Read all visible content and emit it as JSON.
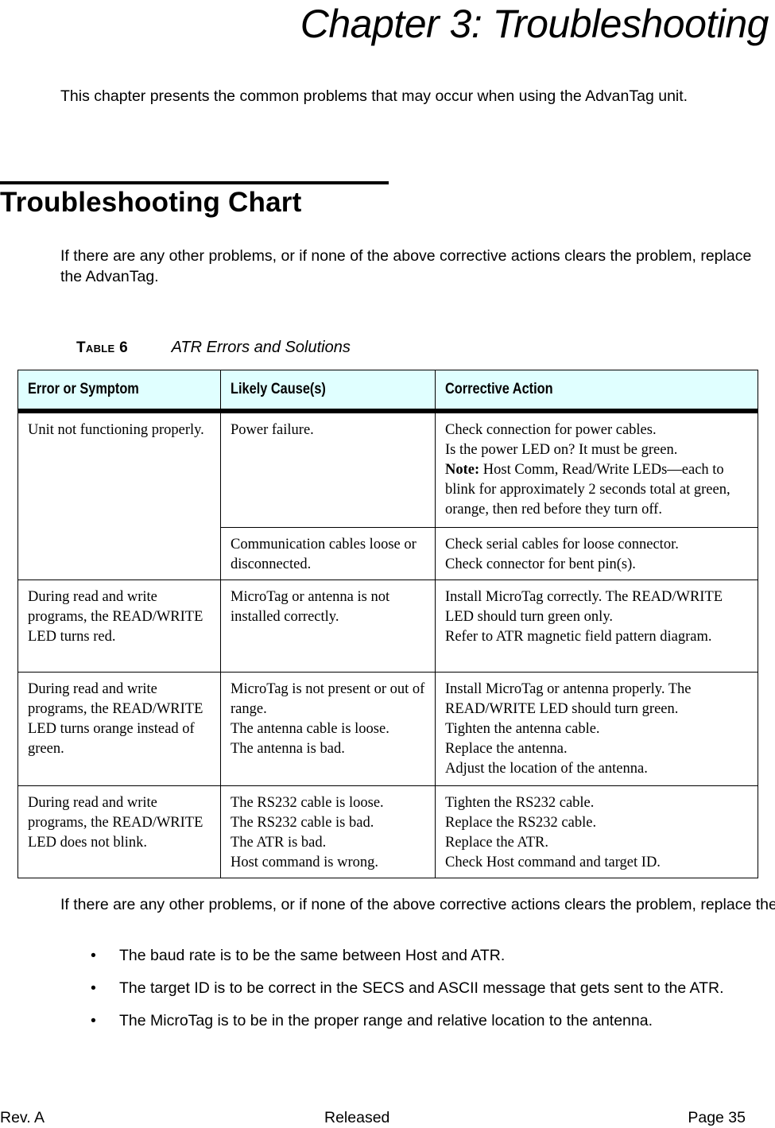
{
  "chapter": {
    "title": "Chapter 3:  Troubleshooting"
  },
  "intro": {
    "text": "This chapter presents the common problems that may occur when using the AdvanTag unit."
  },
  "section": {
    "title": "Troubleshooting Chart",
    "paragraph": "If there are any other problems, or if none of the above corrective actions clears the problem, replace the AdvanTag."
  },
  "table": {
    "caption_label": "Table 6",
    "caption_title": "ATR Errors and Solutions",
    "header_bg": "#e0ffff",
    "columns": [
      "Error or Symptom",
      "Likely Cause(s)",
      "Corrective Action"
    ],
    "rows": [
      {
        "symptom": "Unit not functioning properly.",
        "causes": [
          {
            "cause": [
              "Power failure."
            ],
            "actions": [
              "Check connection for power cables.",
              "Is the power LED on? It must be green."
            ],
            "note_label": "Note:",
            "note_text": " Host Comm, Read/Write LEDs—each to blink for approximately 2 seconds total at green, orange, then red before they turn off."
          },
          {
            "cause": [
              "Communication cables loose or disconnected."
            ],
            "actions": [
              "Check serial cables for loose connector.",
              "Check connector for bent pin(s)."
            ]
          }
        ]
      },
      {
        "symptom": "During read and write programs, the READ/WRITE LED turns red.",
        "cause": [
          "MicroTag or antenna is not installed correctly."
        ],
        "actions": [
          "Install MicroTag correctly. The READ/WRITE LED should turn green only.",
          "Refer to ATR magnetic field pattern diagram."
        ]
      },
      {
        "symptom": "During read and write programs, the READ/WRITE LED turns orange instead of green.",
        "cause": [
          "MicroTag is not present or out of range.",
          "The antenna cable is loose.",
          "The antenna is bad."
        ],
        "actions": [
          "Install MicroTag or antenna properly. The READ/WRITE LED should turn green.",
          "Tighten the antenna cable.",
          "Replace the antenna.",
          "Adjust the location of the antenna."
        ]
      },
      {
        "symptom": "During read and write programs, the READ/WRITE LED does not blink.",
        "cause": [
          "The RS232 cable is loose.",
          "The RS232 cable is bad.",
          "The ATR is bad.",
          "Host command is wrong."
        ],
        "actions": [
          "Tighten the RS232 cable.",
          "Replace the RS232 cable.",
          "Replace the ATR.",
          "Check Host command and target ID."
        ]
      }
    ]
  },
  "after_table": {
    "paragraph": "If there are any other problems, or if none of the above corrective actions clears the problem, replace the AdvanTag. Other considerations to assure proper ATR functioning:",
    "bullet_glyph": "•",
    "bullets": [
      "The baud rate is to be the same between Host and ATR.",
      "The target ID is to be correct in the SECS and ASCII message that gets sent to the ATR.",
      "The MicroTag is to be in the proper range and relative location to the antenna."
    ]
  },
  "footer": {
    "revision": "Rev. A",
    "status": "Released",
    "page": "Page 35"
  }
}
